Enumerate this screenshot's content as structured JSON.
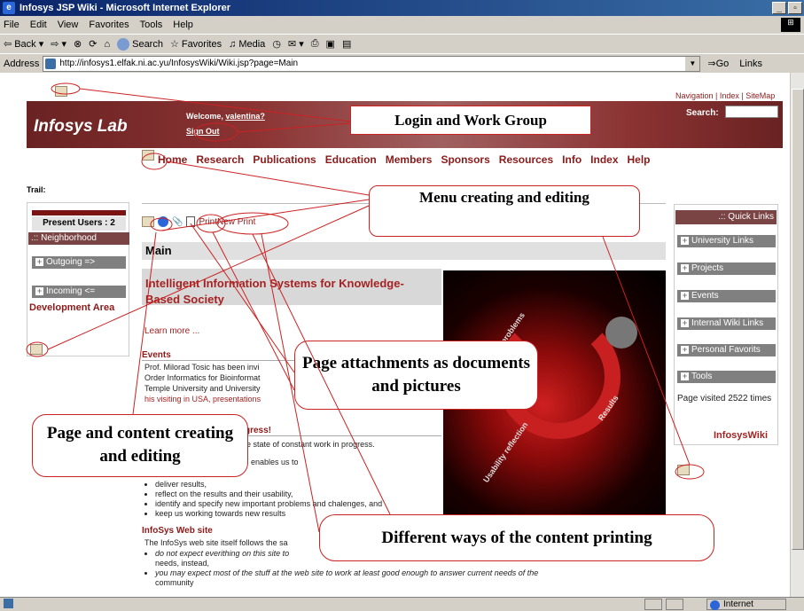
{
  "window": {
    "title": "Infosys JSP Wiki - Microsoft Internet Explorer"
  },
  "menubar": [
    "File",
    "Edit",
    "View",
    "Favorites",
    "Tools",
    "Help"
  ],
  "toolbar": {
    "back": "Back",
    "search": "Search",
    "favorites": "Favorites",
    "media": "Media"
  },
  "address": {
    "label": "Address",
    "url": "http://infosys1.elfak.ni.ac.yu/InfosysWiki/Wiki.jsp?page=Main",
    "go": "Go",
    "links": "Links"
  },
  "status": {
    "zone": "Internet"
  },
  "page": {
    "topnav": "Navigation | Index | SiteMap",
    "logo": "Infosys Lab",
    "welcome_prefix": "Welcome, ",
    "welcome_user": "valentina?",
    "signout": "Sign Out",
    "search_label": "Search:",
    "menu": [
      "Home",
      "Research",
      "Publications",
      "Education",
      "Members",
      "Sponsors",
      "Resources",
      "Info",
      "Index",
      "Help"
    ],
    "trail": "Trail:",
    "left": {
      "present": "Present Users : 2",
      "neighborhood": ".:: Neighborhood",
      "outgoing": "Outgoing =>",
      "incoming": "Incoming <=",
      "development": "Development Area"
    },
    "page_links": "PrintNew  Print",
    "main_title": "Main",
    "heading": "Intelligent Information Systems for Knowledge-Based Society",
    "learn_more": "Learn more ...",
    "events_title": "Events",
    "events_lines": [
      "Prof. Milorad Tosic has been invi",
      "Order Informatics for Bioinformat",
      "Temple University and University",
      "his visiting in USA, presentations"
    ],
    "progress_title": "gress!",
    "progress_line1": "he state of constant work in progress.",
    "progress_line2": "te enables us to",
    "bullets1": [
      "deliver results,",
      "reflect on the results and their usability,",
      "identify and specify new important problems and chalenges, and",
      "keep us working towards new results"
    ],
    "website_title": "InfoSys Web site",
    "website_line": "The InfoSys web site itself follows the sa",
    "bullets2": [
      "do not expect everithing on this site to",
      "needs, instead,",
      "you may expect most of the stuff at the web site to work at least good enough to answer current needs of the",
      "community"
    ],
    "right": {
      "quick_links": ".:: Quick Links",
      "items": [
        "University Links",
        "Projects",
        "Events",
        "Internal Wiki Links",
        "Personal Favorits",
        "Tools"
      ],
      "visited": "Page visited 2522 times",
      "infosyswiki": "InfosysWiki"
    },
    "image_words": [
      "problems",
      "Results",
      "Usability reflection"
    ]
  },
  "callouts": {
    "login": "Login and Work Group",
    "menu": "Menu creating and editing",
    "attachments": "Page attachments as documents and pictures",
    "page_content": "Page and content creating and editing",
    "printing": "Different ways of the content printing"
  },
  "colors": {
    "accent": "#8b1a1a",
    "callout_border": "#cc2222",
    "header": "#8b3333"
  }
}
